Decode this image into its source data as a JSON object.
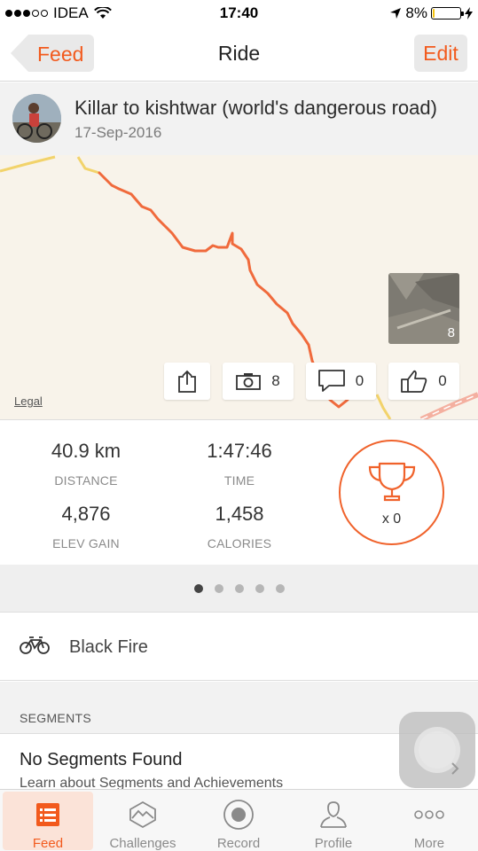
{
  "status_bar": {
    "carrier": "IDEA",
    "time": "17:40",
    "battery": "8%",
    "battery_level": 0.08
  },
  "nav": {
    "back_label": "Feed",
    "title": "Ride",
    "edit_label": "Edit"
  },
  "activity": {
    "title": "Killar to kishtwar (world's dangerous road)",
    "date": "17-Sep-2016"
  },
  "map": {
    "legal_label": "Legal",
    "photo_count": "8",
    "buttons": {
      "photos_count": "8",
      "comments_count": "0",
      "kudos_count": "0"
    },
    "colors": {
      "route": "#f06a3c",
      "road": "#f2d36b",
      "background": "#f8f3ea"
    }
  },
  "stats": {
    "distance": {
      "value": "40.9 km",
      "label": "DISTANCE"
    },
    "time": {
      "value": "1:47:46",
      "label": "TIME"
    },
    "elev_gain": {
      "value": "4,876",
      "label": "ELEV GAIN"
    },
    "calories": {
      "value": "1,458",
      "label": "CALORIES"
    },
    "achievements": "x 0"
  },
  "pager": {
    "pages": 5,
    "active": 1
  },
  "gear": {
    "name": "Black Fire"
  },
  "segments": {
    "header": "SEGMENTS",
    "empty_title": "No Segments Found",
    "learn_link": "Learn about Segments and Achievements"
  },
  "tabs": [
    {
      "label": "Feed",
      "icon": "feed-icon",
      "active": true
    },
    {
      "label": "Challenges",
      "icon": "challenges-icon",
      "active": false
    },
    {
      "label": "Record",
      "icon": "record-icon",
      "active": false
    },
    {
      "label": "Profile",
      "icon": "profile-icon",
      "active": false
    },
    {
      "label": "More",
      "icon": "more-icon",
      "active": false
    }
  ],
  "colors": {
    "accent": "#f25a1d"
  }
}
